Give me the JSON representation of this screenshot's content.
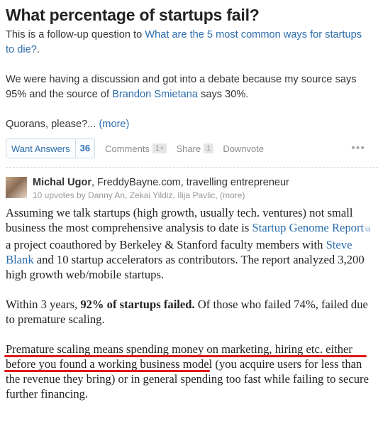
{
  "question": {
    "title": "What percentage of startups fail?",
    "followup_prefix": "This is a follow-up question to ",
    "followup_link": "What are the 5 most common ways for startups to die?",
    "followup_suffix": ".",
    "para2_prefix": "We were having a discussion and got into a debate because my source says 95% and the source of ",
    "para2_link": "Brandon Smietana",
    "para2_suffix": " says 30%.",
    "para3": "Quorans, please?...",
    "more": "(more)"
  },
  "actions": {
    "want_answers": "Want Answers",
    "want_count": "36",
    "comments": "Comments",
    "comments_count": "1+",
    "share": "Share",
    "share_count": "1",
    "downvote": "Downvote",
    "more_dots": "•••"
  },
  "answer": {
    "author_name": "Michal Ugor",
    "author_bio": ", FreddyBayne.com, travelling entrepreneur",
    "upvotes": "10 upvotes by Danny An, Zekai Yildiz, Ilija Pavlic, (more)",
    "p1_a": "Assuming we talk startups (high growth, usually tech. ventures) not small business the most comprehensive analysis to date is ",
    "p1_link1": "Startup Genome Report",
    "p1_b": " a project coauthored by Berkeley & Stanford faculty members with ",
    "p1_link2": "Steve Blank",
    "p1_c": " and 10 startup accelerators as contributors. The report analyzed 3,200 high growth web/mobile startups.",
    "p2_a": "Within 3 years, ",
    "p2_bold": "92% of startups failed.",
    "p2_b": " Of those who failed 74%, failed due to premature scaling.",
    "p3_a": "Premature scaling means spending money on marketing, hiring etc. either before you found a working business model",
    "p3_b": " (you acquire users for less than the revenue they bring) or in general spending too fast while failing to secure further financing."
  },
  "colors": {
    "link": "#2b6dad",
    "highlight_underline": "#e0181a"
  },
  "icons": {
    "external": "external-link-icon",
    "avatar": "avatar"
  }
}
